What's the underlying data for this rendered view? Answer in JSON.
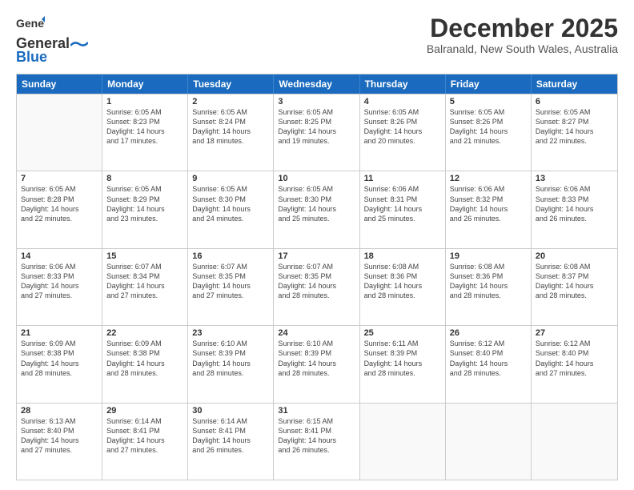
{
  "header": {
    "logo_general": "General",
    "logo_blue": "Blue",
    "title": "December 2025",
    "subtitle": "Balranald, New South Wales, Australia"
  },
  "days_of_week": [
    "Sunday",
    "Monday",
    "Tuesday",
    "Wednesday",
    "Thursday",
    "Friday",
    "Saturday"
  ],
  "weeks": [
    [
      {
        "day": "",
        "info": ""
      },
      {
        "day": "1",
        "info": "Sunrise: 6:05 AM\nSunset: 8:23 PM\nDaylight: 14 hours\nand 17 minutes."
      },
      {
        "day": "2",
        "info": "Sunrise: 6:05 AM\nSunset: 8:24 PM\nDaylight: 14 hours\nand 18 minutes."
      },
      {
        "day": "3",
        "info": "Sunrise: 6:05 AM\nSunset: 8:25 PM\nDaylight: 14 hours\nand 19 minutes."
      },
      {
        "day": "4",
        "info": "Sunrise: 6:05 AM\nSunset: 8:26 PM\nDaylight: 14 hours\nand 20 minutes."
      },
      {
        "day": "5",
        "info": "Sunrise: 6:05 AM\nSunset: 8:26 PM\nDaylight: 14 hours\nand 21 minutes."
      },
      {
        "day": "6",
        "info": "Sunrise: 6:05 AM\nSunset: 8:27 PM\nDaylight: 14 hours\nand 22 minutes."
      }
    ],
    [
      {
        "day": "7",
        "info": "Sunrise: 6:05 AM\nSunset: 8:28 PM\nDaylight: 14 hours\nand 22 minutes."
      },
      {
        "day": "8",
        "info": "Sunrise: 6:05 AM\nSunset: 8:29 PM\nDaylight: 14 hours\nand 23 minutes."
      },
      {
        "day": "9",
        "info": "Sunrise: 6:05 AM\nSunset: 8:30 PM\nDaylight: 14 hours\nand 24 minutes."
      },
      {
        "day": "10",
        "info": "Sunrise: 6:05 AM\nSunset: 8:30 PM\nDaylight: 14 hours\nand 25 minutes."
      },
      {
        "day": "11",
        "info": "Sunrise: 6:06 AM\nSunset: 8:31 PM\nDaylight: 14 hours\nand 25 minutes."
      },
      {
        "day": "12",
        "info": "Sunrise: 6:06 AM\nSunset: 8:32 PM\nDaylight: 14 hours\nand 26 minutes."
      },
      {
        "day": "13",
        "info": "Sunrise: 6:06 AM\nSunset: 8:33 PM\nDaylight: 14 hours\nand 26 minutes."
      }
    ],
    [
      {
        "day": "14",
        "info": "Sunrise: 6:06 AM\nSunset: 8:33 PM\nDaylight: 14 hours\nand 27 minutes."
      },
      {
        "day": "15",
        "info": "Sunrise: 6:07 AM\nSunset: 8:34 PM\nDaylight: 14 hours\nand 27 minutes."
      },
      {
        "day": "16",
        "info": "Sunrise: 6:07 AM\nSunset: 8:35 PM\nDaylight: 14 hours\nand 27 minutes."
      },
      {
        "day": "17",
        "info": "Sunrise: 6:07 AM\nSunset: 8:35 PM\nDaylight: 14 hours\nand 28 minutes."
      },
      {
        "day": "18",
        "info": "Sunrise: 6:08 AM\nSunset: 8:36 PM\nDaylight: 14 hours\nand 28 minutes."
      },
      {
        "day": "19",
        "info": "Sunrise: 6:08 AM\nSunset: 8:36 PM\nDaylight: 14 hours\nand 28 minutes."
      },
      {
        "day": "20",
        "info": "Sunrise: 6:08 AM\nSunset: 8:37 PM\nDaylight: 14 hours\nand 28 minutes."
      }
    ],
    [
      {
        "day": "21",
        "info": "Sunrise: 6:09 AM\nSunset: 8:38 PM\nDaylight: 14 hours\nand 28 minutes."
      },
      {
        "day": "22",
        "info": "Sunrise: 6:09 AM\nSunset: 8:38 PM\nDaylight: 14 hours\nand 28 minutes."
      },
      {
        "day": "23",
        "info": "Sunrise: 6:10 AM\nSunset: 8:39 PM\nDaylight: 14 hours\nand 28 minutes."
      },
      {
        "day": "24",
        "info": "Sunrise: 6:10 AM\nSunset: 8:39 PM\nDaylight: 14 hours\nand 28 minutes."
      },
      {
        "day": "25",
        "info": "Sunrise: 6:11 AM\nSunset: 8:39 PM\nDaylight: 14 hours\nand 28 minutes."
      },
      {
        "day": "26",
        "info": "Sunrise: 6:12 AM\nSunset: 8:40 PM\nDaylight: 14 hours\nand 28 minutes."
      },
      {
        "day": "27",
        "info": "Sunrise: 6:12 AM\nSunset: 8:40 PM\nDaylight: 14 hours\nand 27 minutes."
      }
    ],
    [
      {
        "day": "28",
        "info": "Sunrise: 6:13 AM\nSunset: 8:40 PM\nDaylight: 14 hours\nand 27 minutes."
      },
      {
        "day": "29",
        "info": "Sunrise: 6:14 AM\nSunset: 8:41 PM\nDaylight: 14 hours\nand 27 minutes."
      },
      {
        "day": "30",
        "info": "Sunrise: 6:14 AM\nSunset: 8:41 PM\nDaylight: 14 hours\nand 26 minutes."
      },
      {
        "day": "31",
        "info": "Sunrise: 6:15 AM\nSunset: 8:41 PM\nDaylight: 14 hours\nand 26 minutes."
      },
      {
        "day": "",
        "info": ""
      },
      {
        "day": "",
        "info": ""
      },
      {
        "day": "",
        "info": ""
      }
    ]
  ]
}
